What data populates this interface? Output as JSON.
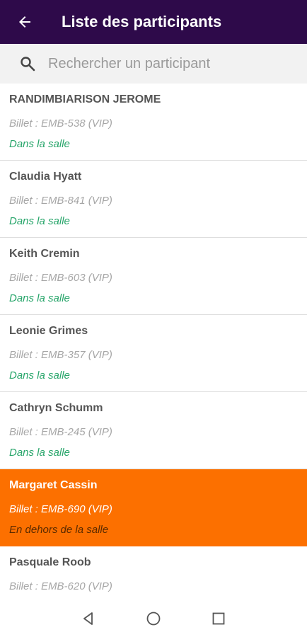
{
  "app_bar": {
    "title": "Liste des participants",
    "back_icon": "arrow-left-icon",
    "background_color": "#2e0a4a"
  },
  "search": {
    "placeholder": "Rechercher un participant",
    "value": "",
    "icon": "search-icon"
  },
  "participants": [
    {
      "name": "RANDIMBIARISON JEROME",
      "ticket": "Billet : EMB-538 (VIP)",
      "status": "Dans la salle",
      "selected": false
    },
    {
      "name": "Claudia Hyatt",
      "ticket": "Billet : EMB-841 (VIP)",
      "status": "Dans la salle",
      "selected": false
    },
    {
      "name": "Keith Cremin",
      "ticket": "Billet : EMB-603 (VIP)",
      "status": "Dans la salle",
      "selected": false
    },
    {
      "name": "Leonie Grimes",
      "ticket": "Billet : EMB-357 (VIP)",
      "status": "Dans la salle",
      "selected": false
    },
    {
      "name": "Cathryn Schumm",
      "ticket": "Billet : EMB-245 (VIP)",
      "status": "Dans la salle",
      "selected": false
    },
    {
      "name": "Margaret Cassin",
      "ticket": "Billet : EMB-690 (VIP)",
      "status": "En dehors de la salle",
      "selected": true
    },
    {
      "name": "Pasquale Roob",
      "ticket": "Billet : EMB-620 (VIP)",
      "status": "",
      "selected": false
    }
  ],
  "colors": {
    "status_in": "#27a56a",
    "selected_row": "#fc7000"
  },
  "nav": {
    "back_icon": "triangle-back-icon",
    "home_icon": "circle-home-icon",
    "recents_icon": "square-recents-icon"
  }
}
